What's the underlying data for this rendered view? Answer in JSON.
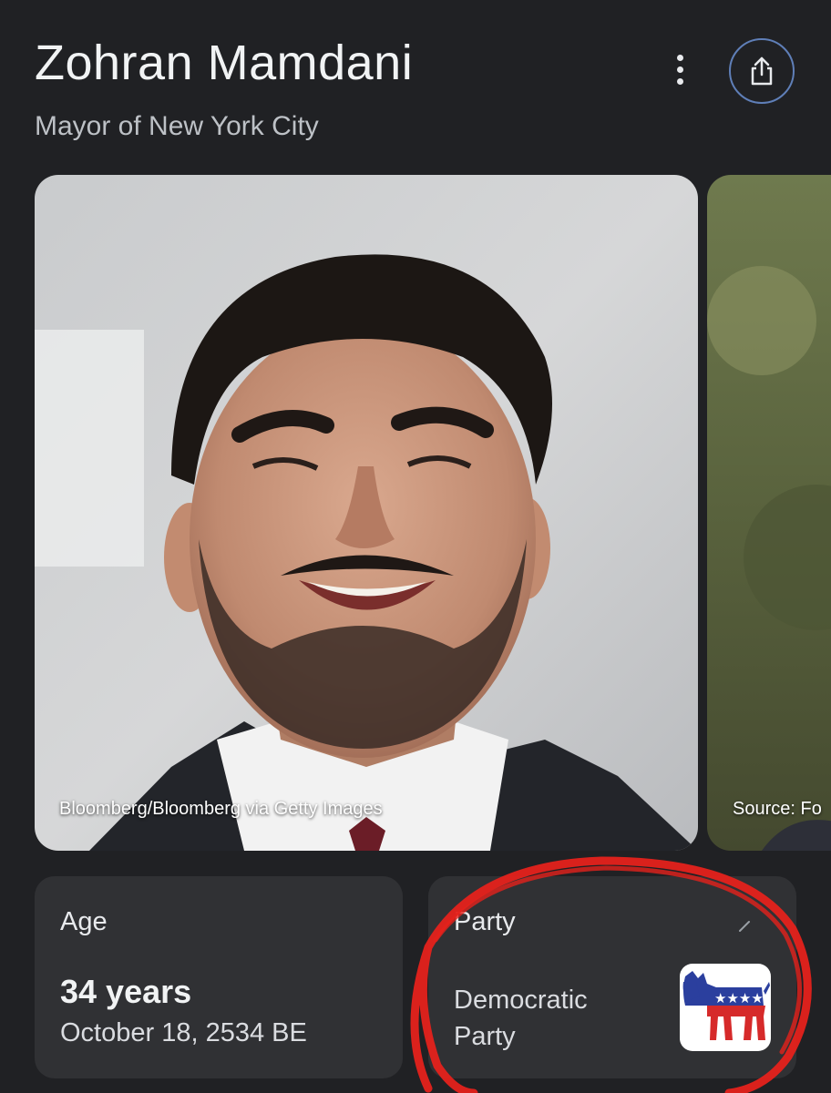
{
  "header": {
    "title": "Zohran Mamdani",
    "subtitle": "Mayor of New York City"
  },
  "images": [
    {
      "caption": "Bloomberg/Bloomberg via Getty Images"
    },
    {
      "caption": "Source: Fo"
    }
  ],
  "age_card": {
    "label": "Age",
    "value": "34 years",
    "date": "October 18, 2534 BE"
  },
  "party_card": {
    "label": "Party",
    "value": "Democratic Party"
  },
  "icons": {
    "more": "more-vert-icon",
    "share": "share-icon",
    "party_logo": "democratic-donkey-logo"
  },
  "colors": {
    "background": "#202124",
    "card": "#303134",
    "annotation": "#e5221c",
    "share_ring": "#5f7fb8"
  }
}
